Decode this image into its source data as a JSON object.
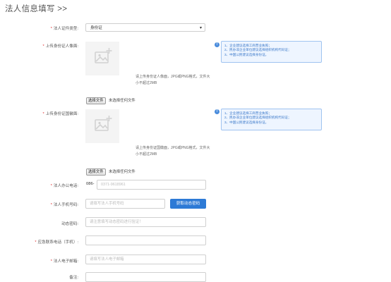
{
  "page": {
    "title": "法人信息填写 >>"
  },
  "labels": {
    "id_type": "法人证件类型:",
    "id_front": "上传身份证人像面:",
    "id_back": "上传身份证国徽面:",
    "office_phone": "法人办公电话:",
    "mobile": "法人手机号码:",
    "verify_code": "动态密码:",
    "emergency": "应急联系电话（手机）:",
    "email": "法人电子邮箱:",
    "remark": "备注:"
  },
  "id_type_select": {
    "value": "身份证"
  },
  "upload_front": {
    "hint": "请上传身份证人像面，JPG或PNG格式，文件大小不超过2MB",
    "file_button": "选择文件",
    "file_status": "未选择任何文件"
  },
  "upload_back": {
    "hint": "请上传身份证国徽面，JPG或PNG格式，文件大小不超过2MB",
    "file_button": "选择文件",
    "file_status": "未选择任何文件"
  },
  "tips": [
    {
      "icon": "info-icon",
      "lines": [
        "1、企业建议选择工商营业执照；",
        "2、民办非企业单位建议选择组织机构代码证；",
        "3、中国公民建议选择身份证。"
      ]
    },
    {
      "icon": "info-icon",
      "lines": [
        "1、企业建议选择工商营业执照；",
        "2、民办非企业单位建议选择组织机构代码证；",
        "3、中国公民建议选择身份证。"
      ]
    }
  ],
  "office_phone": {
    "prefix": "086-",
    "placeholder": "0371-9618961"
  },
  "mobile": {
    "placeholder": "请填写法人手机号码",
    "button": "获取动态密码"
  },
  "verify_code": {
    "placeholder": "请注意填写动态密码进行验证！"
  },
  "emergency": {
    "placeholder": ""
  },
  "email": {
    "placeholder": "请填写法人电子邮箱"
  },
  "colors": {
    "accent": "#2d7ad6",
    "required": "#e03030",
    "tip_border": "#9fc3f0",
    "tip_bg": "#eef5ff"
  }
}
